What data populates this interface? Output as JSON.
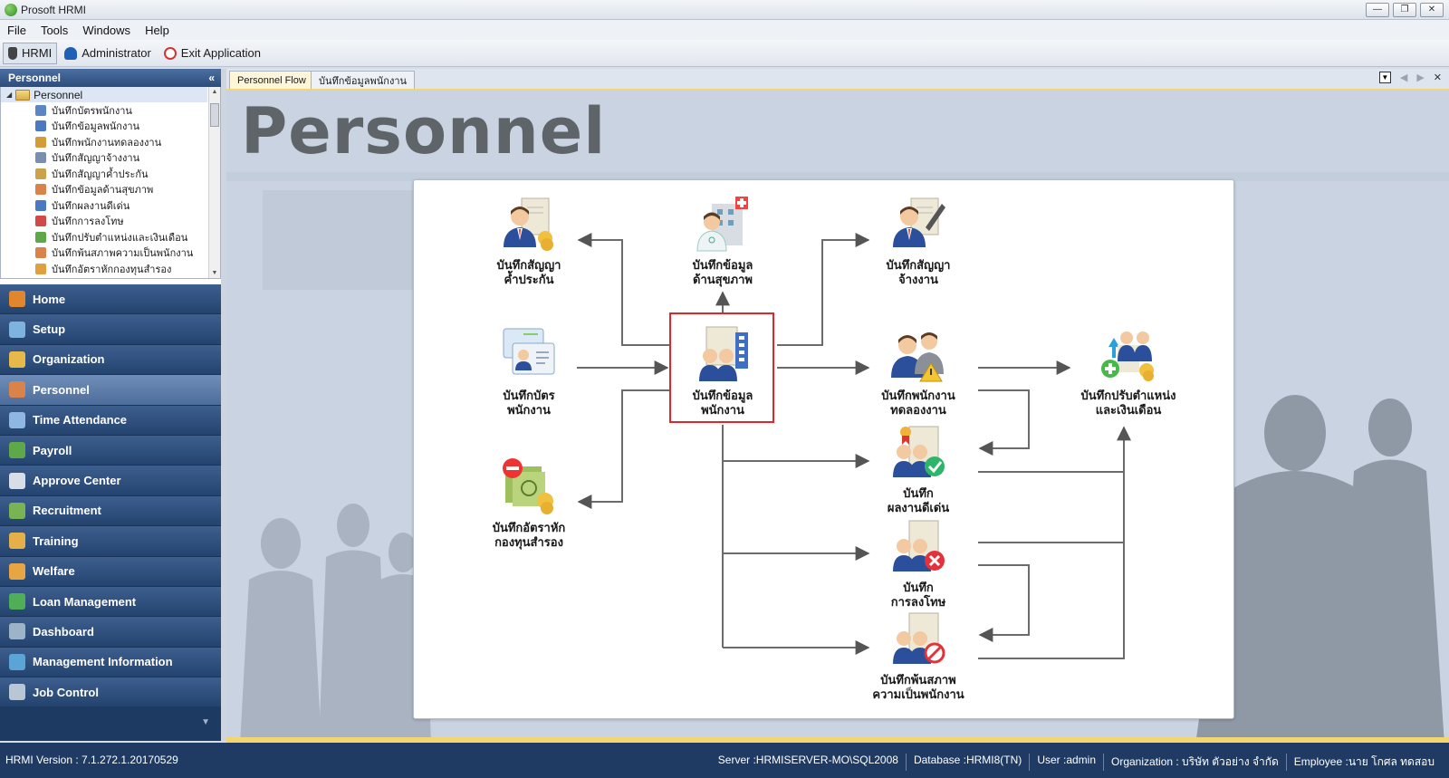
{
  "window": {
    "title": "Prosoft HRMI",
    "controls": [
      "minimize",
      "restore",
      "close"
    ]
  },
  "menu": [
    "File",
    "Tools",
    "Windows",
    "Help"
  ],
  "toolbar": [
    {
      "label": "HRMI",
      "icon": "hrmi-icon",
      "pressed": true
    },
    {
      "label": "Administrator",
      "icon": "admin-shield-icon",
      "pressed": false
    },
    {
      "label": "Exit Application",
      "icon": "exit-icon",
      "pressed": false
    }
  ],
  "left_panel": {
    "title": "Personnel",
    "tree": {
      "root": "Personnel",
      "items": [
        "บันทึกบัตรพนักงาน",
        "บันทึกข้อมูลพนักงาน",
        "บันทึกพนักงานทดลองงาน",
        "บันทึกสัญญาจ้างงาน",
        "บันทึกสัญญาค้ำประกัน",
        "บันทึกข้อมูลด้านสุขภาพ",
        "บันทึกผลงานดีเด่น",
        "บันทึกการลงโทษ",
        "บันทึกปรับตำแหน่งและเงินเดือน",
        "บันทึกพ้นสภาพความเป็นพนักงาน",
        "บันทึกอัตราหักกองทุนสำรอง"
      ]
    },
    "nav": [
      {
        "label": "Home",
        "icon": "home-icon",
        "color": "#e0872e"
      },
      {
        "label": "Setup",
        "icon": "setup-icon",
        "color": "#7fb3df"
      },
      {
        "label": "Organization",
        "icon": "organization-icon",
        "color": "#e7b84a"
      },
      {
        "label": "Personnel",
        "icon": "personnel-icon",
        "color": "#d9834a",
        "active": true
      },
      {
        "label": "Time Attendance",
        "icon": "time-attendance-icon",
        "color": "#8fb7e3"
      },
      {
        "label": "Payroll",
        "icon": "payroll-icon",
        "color": "#5fa84a"
      },
      {
        "label": "Approve Center",
        "icon": "approve-icon",
        "color": "#d7dee8"
      },
      {
        "label": "Recruitment",
        "icon": "recruitment-icon",
        "color": "#78b354"
      },
      {
        "label": "Training",
        "icon": "training-icon",
        "color": "#e5b04a"
      },
      {
        "label": "Welfare",
        "icon": "welfare-icon",
        "color": "#e8a543"
      },
      {
        "label": "Loan Management",
        "icon": "loan-icon",
        "color": "#4fae57"
      },
      {
        "label": "Dashboard",
        "icon": "dashboard-icon",
        "color": "#9cb3c8"
      },
      {
        "label": "Management Information",
        "icon": "management-info-icon",
        "color": "#5aa5d6"
      },
      {
        "label": "Job Control",
        "icon": "job-control-icon",
        "color": "#b8c6d6"
      }
    ]
  },
  "tabs": [
    {
      "label": "Personnel Flow",
      "active": true
    },
    {
      "label": "บันทึกข้อมูลพนักงาน",
      "active": false
    }
  ],
  "content": {
    "heading": "Personnel",
    "flow": {
      "nodes": {
        "guarantee": {
          "l1": "บันทึกสัญญา",
          "l2": "ค้ำประกัน",
          "icon": "guarantee-contract-icon"
        },
        "health": {
          "l1": "บันทึกข้อมูล",
          "l2": "ด้านสุขภาพ",
          "icon": "health-record-icon"
        },
        "employment": {
          "l1": "บันทึกสัญญา",
          "l2": "จ้างงาน",
          "icon": "employment-contract-icon"
        },
        "card": {
          "l1": "บันทึกบัตร",
          "l2": "พนักงาน",
          "icon": "employee-card-icon"
        },
        "employee": {
          "l1": "บันทึกข้อมูล",
          "l2": "พนักงาน",
          "icon": "employee-data-icon"
        },
        "probation": {
          "l1": "บันทึกพนักงาน",
          "l2": "ทดลองงาน",
          "icon": "probation-icon"
        },
        "adjust": {
          "l1": "บันทึกปรับตำแหน่ง",
          "l2": "และเงินเดือน",
          "icon": "position-salary-icon"
        },
        "award": {
          "l1": "บันทึก",
          "l2": "ผลงานดีเด่น",
          "icon": "award-icon"
        },
        "provident": {
          "l1": "บันทึกอัตราหัก",
          "l2": "กองทุนสำรอง",
          "icon": "provident-fund-icon"
        },
        "penalty": {
          "l1": "บันทึก",
          "l2": "การลงโทษ",
          "icon": "penalty-icon"
        },
        "termination": {
          "l1": "บันทึกพ้นสภาพ",
          "l2": "ความเป็นพนักงาน",
          "icon": "termination-icon"
        }
      }
    }
  },
  "status": {
    "version": "HRMI Version : 7.1.272.1.20170529",
    "server": "Server :HRMISERVER-MO\\SQL2008",
    "database": "Database :HRMI8(TN)",
    "user": "User :admin",
    "organization": "Organization : บริษัท ตัวอย่าง จำกัด",
    "employee": "Employee :นาย โกศล ทดสอบ"
  }
}
